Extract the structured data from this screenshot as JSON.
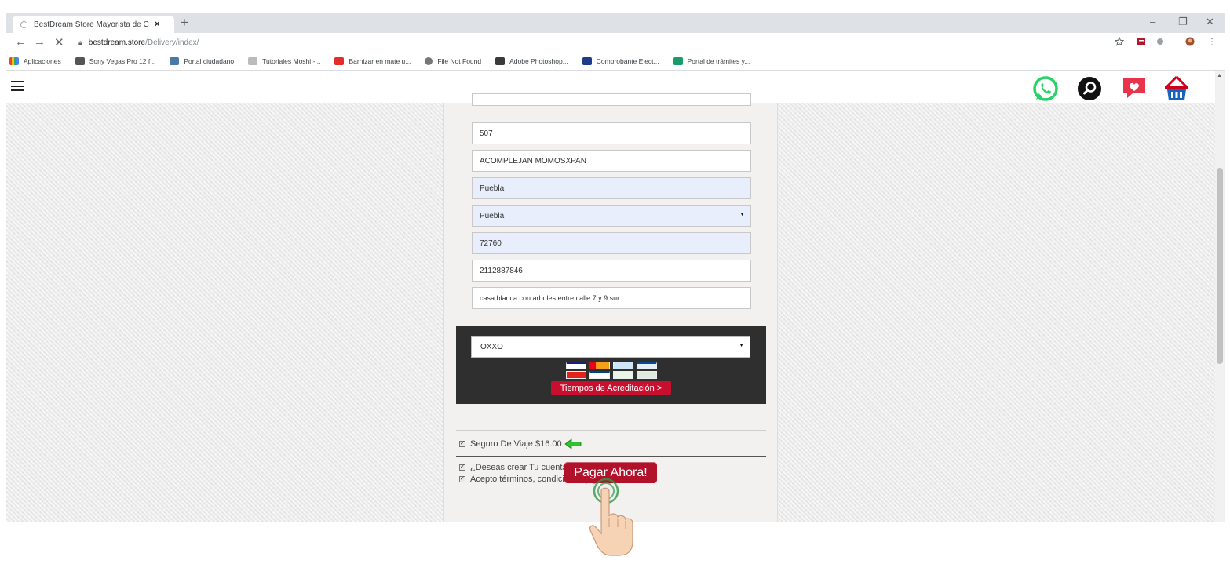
{
  "browser": {
    "tab_title": "BestDream Store Mayorista de C",
    "tab_close": "×",
    "new_tab": "+",
    "url_host": "bestdream.store",
    "url_path": "/Delivery/index/",
    "bookmarks": [
      {
        "label": "Aplicaciones",
        "color": "#4285f4"
      },
      {
        "label": "Sony Vegas Pro 12 f...",
        "color": "#555555"
      },
      {
        "label": "Portal ciudadano",
        "color": "#4a7aa8"
      },
      {
        "label": "Tutoriales Moshi -...",
        "color": "#7d7d7d"
      },
      {
        "label": "Barnizar en mate u...",
        "color": "#e52d27"
      },
      {
        "label": "File Not Found",
        "color": "#666666"
      },
      {
        "label": "Adobe Photoshop...",
        "color": "#3b3b3b"
      },
      {
        "label": "Comprobante Elect...",
        "color": "#1f3c88"
      },
      {
        "label": "Portal de trámites y...",
        "color": "#1a9c6a"
      }
    ]
  },
  "form": {
    "field_number": "507",
    "field_colonia": "ACOMPLEJAN MOMOSXPAN",
    "field_ciudad": "Puebla",
    "field_estado": "Puebla",
    "field_cp": "72760",
    "field_telefono": "2112887846",
    "field_referencias": "casa blanca con arboles entre calle 7 y 9 sur"
  },
  "payment": {
    "method": "OXXO",
    "tiempos_label": "Tiempos de Acreditación >"
  },
  "options": {
    "seguro_label": "Seguro De Viaje $16.00",
    "crear_cuenta_label": "¿Deseas crear Tu cuenta con estos datos?",
    "acepto_label": "Acepto términos, condiciones y garantía"
  },
  "cta": {
    "pay_label": "Pagar Ahora!"
  },
  "colors": {
    "whatsapp": "#25d366",
    "basket": "#d0021b",
    "heart": "#e8334a",
    "pay_button": "#b1122a"
  }
}
